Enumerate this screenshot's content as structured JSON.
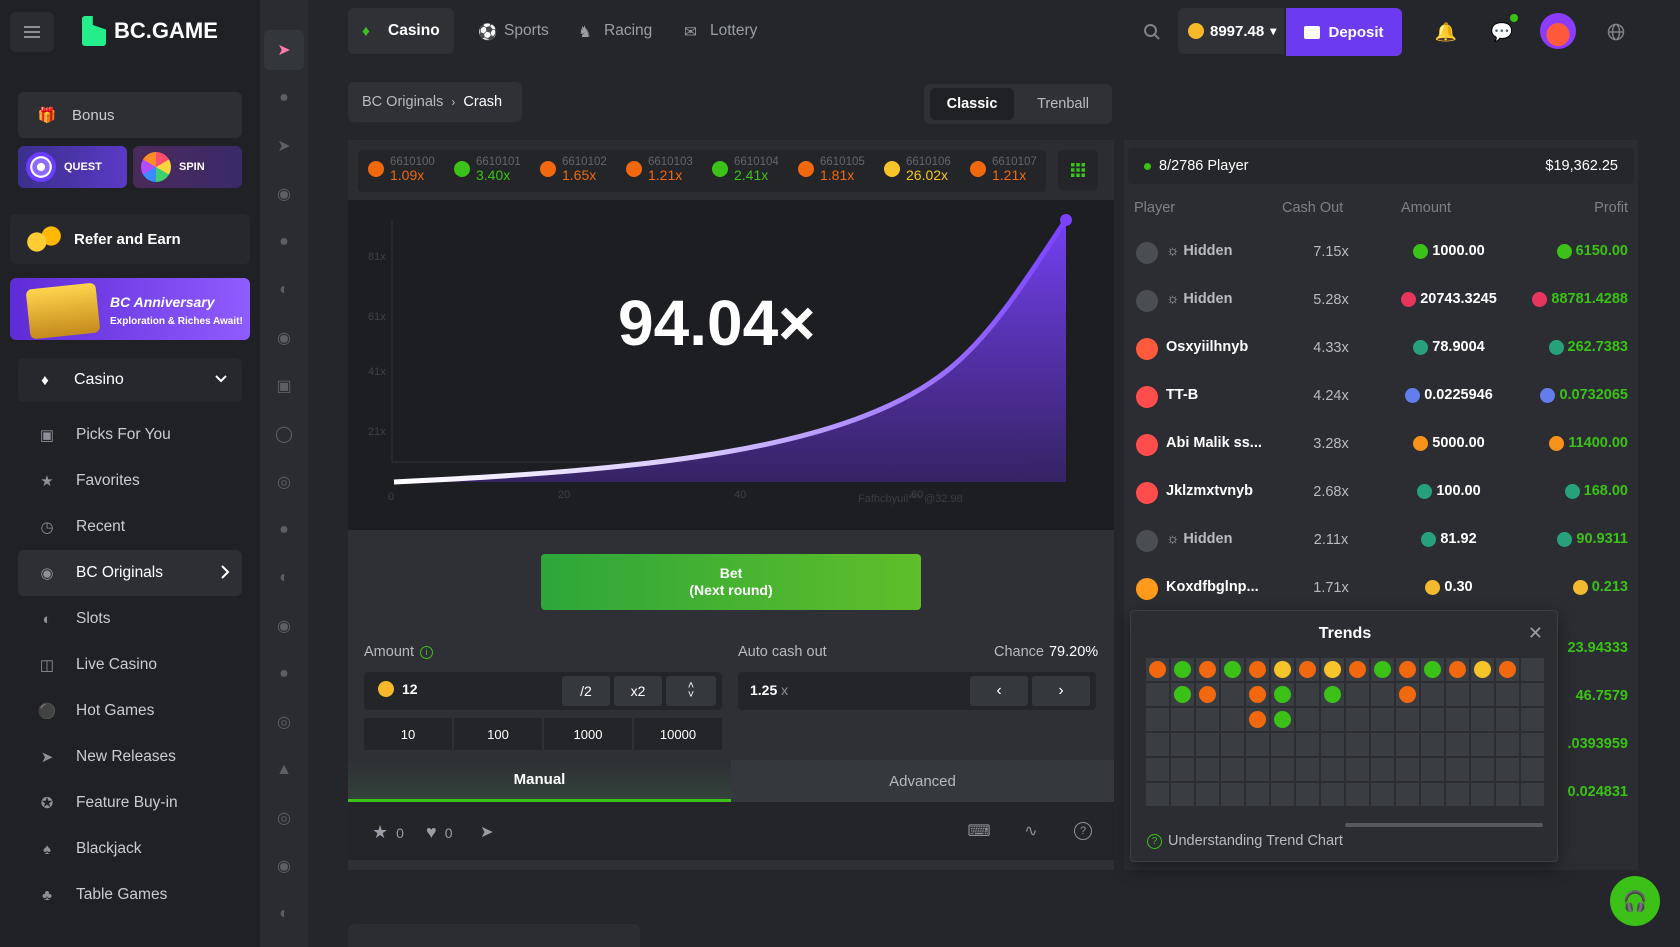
{
  "brand": {
    "name": "BC.GAME"
  },
  "sidebar": {
    "bonus_label": "Bonus",
    "quest_label": "QUEST",
    "spin_label": "SPIN",
    "refer_label": "Refer and Earn",
    "anniversary_title": "BC Anniversary",
    "anniversary_sub": "Exploration & Riches Await!",
    "casino_label": "Casino",
    "items": [
      {
        "label": "Picks For You",
        "icon": "grid-icon"
      },
      {
        "label": "Favorites",
        "icon": "star-icon"
      },
      {
        "label": "Recent",
        "icon": "clock-icon"
      },
      {
        "label": "BC Originals",
        "icon": "originals-icon"
      },
      {
        "label": "Slots",
        "icon": "slots-icon"
      },
      {
        "label": "Live Casino",
        "icon": "live-casino-icon"
      },
      {
        "label": "Hot Games",
        "icon": "fire-icon"
      },
      {
        "label": "New Releases",
        "icon": "rocket-icon"
      },
      {
        "label": "Feature Buy-in",
        "icon": "feature-star-icon"
      },
      {
        "label": "Blackjack",
        "icon": "cards-icon"
      },
      {
        "label": "Table Games",
        "icon": "table-cards-icon"
      }
    ]
  },
  "topbar": {
    "tabs": [
      {
        "label": "Casino"
      },
      {
        "label": "Sports"
      },
      {
        "label": "Racing"
      },
      {
        "label": "Lottery"
      }
    ],
    "balance": "8997.48",
    "deposit_label": "Deposit"
  },
  "breadcrumb": {
    "parent": "BC Originals",
    "current": "Crash"
  },
  "modes": {
    "classic": "Classic",
    "trenball": "Trenball"
  },
  "history": [
    {
      "id": "6610100",
      "value": "1.09x",
      "color": "#f1680f"
    },
    {
      "id": "6610101",
      "value": "3.40x",
      "color": "#3bc117"
    },
    {
      "id": "6610102",
      "value": "1.65x",
      "color": "#f1680f"
    },
    {
      "id": "6610103",
      "value": "1.21x",
      "color": "#f1680f"
    },
    {
      "id": "6610104",
      "value": "2.41x",
      "color": "#3bc117"
    },
    {
      "id": "6610105",
      "value": "1.81x",
      "color": "#f1680f"
    },
    {
      "id": "6610106",
      "value": "26.02x",
      "color": "#f7c429"
    },
    {
      "id": "6610107",
      "value": "1.21x",
      "color": "#f1680f"
    }
  ],
  "game": {
    "multiplier": "94.04×",
    "y_ticks": [
      "81x",
      "61x",
      "41x",
      "21x"
    ],
    "x_ticks": [
      "0",
      "20",
      "40",
      "60"
    ],
    "watermark": "Fafhcbyuil*** @32.98",
    "bet_label_1": "Bet",
    "bet_label_2": "(Next round)",
    "amount_label": "Amount",
    "amount_value": "12",
    "half_label": "/2",
    "double_label": "x2",
    "quick": [
      "10",
      "100",
      "1000",
      "10000"
    ],
    "autocash_label": "Auto cash out",
    "chance_label": "Chance",
    "chance_value": "79.20%",
    "autocash_value": "1.25",
    "autocash_unit": "x",
    "manual_label": "Manual",
    "advanced_label": "Advanced",
    "likes": "0",
    "favs": "0"
  },
  "panel": {
    "players": "8/2786 Player",
    "total": "$19,362.25",
    "cols": {
      "player": "Player",
      "cashout": "Cash Out",
      "amount": "Amount",
      "profit": "Profit"
    },
    "rows": [
      {
        "name": "Hidden",
        "hidden": true,
        "cash": "7.15x",
        "amount": "1000.00",
        "profit": "6150.00",
        "coin": "#3bc117",
        "av": "#4a4d52"
      },
      {
        "name": "Hidden",
        "hidden": true,
        "cash": "5.28x",
        "amount": "20743.3245",
        "profit": "88781.4288",
        "coin": "#e8355d",
        "av": "#4a4d52"
      },
      {
        "name": "Osxyiilhnyb",
        "hidden": false,
        "cash": "4.33x",
        "amount": "78.9004",
        "profit": "262.7383",
        "coin": "#26a17b",
        "av": "#ff5a3c"
      },
      {
        "name": "TT-B",
        "hidden": false,
        "cash": "4.24x",
        "amount": "0.0225946",
        "profit": "0.0732065",
        "coin": "#627eea",
        "av": "#ff4d4d"
      },
      {
        "name": "Abi Malik ss...",
        "hidden": false,
        "cash": "3.28x",
        "amount": "5000.00",
        "profit": "11400.00",
        "coin": "#f7931a",
        "av": "#ff4d4d"
      },
      {
        "name": "Jklzmxtvnyb",
        "hidden": false,
        "cash": "2.68x",
        "amount": "100.00",
        "profit": "168.00",
        "coin": "#26a17b",
        "av": "#ff4d4d"
      },
      {
        "name": "Hidden",
        "hidden": true,
        "cash": "2.11x",
        "amount": "81.92",
        "profit": "90.9311",
        "coin": "#26a17b",
        "av": "#4a4d52"
      },
      {
        "name": "Koxdfbglnp...",
        "hidden": false,
        "cash": "1.71x",
        "amount": "0.30",
        "profit": "0.213",
        "coin": "#f3ba2f",
        "av": "#ff9a1c"
      }
    ],
    "peek_profits": [
      "23.94333",
      "46.7579",
      ".0393959",
      "0.024831"
    ]
  },
  "trends": {
    "title": "Trends",
    "footer": "Understanding Trend Chart",
    "columns": [
      [
        "o"
      ],
      [
        "g",
        "g"
      ],
      [
        "o",
        "o"
      ],
      [
        "g"
      ],
      [
        "o",
        "o",
        "o"
      ],
      [
        "y",
        "g",
        "g"
      ],
      [
        "o"
      ],
      [
        "y",
        "g"
      ],
      [
        "o"
      ],
      [
        "g"
      ],
      [
        "o",
        "o"
      ],
      [
        "g"
      ],
      [
        "o"
      ],
      [
        "y"
      ],
      [
        "o"
      ],
      []
    ],
    "colors": {
      "o": "#f1680f",
      "g": "#3bc117",
      "y": "#f7c429"
    }
  }
}
